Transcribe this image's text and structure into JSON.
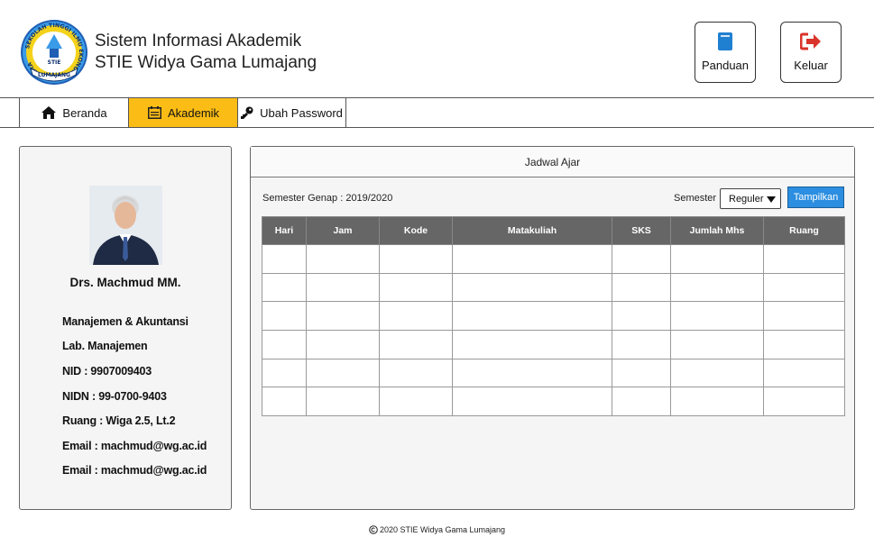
{
  "header": {
    "title_line1": "Sistem Informasi Akademik",
    "title_line2": "STIE Widya Gama Lumajang",
    "logo_ring_text": "SEKOLAH TINGGI ILMU EKONOMI WIDYA GAMA",
    "logo_center_text": "STIE",
    "logo_banner_text": "LUMAJANG",
    "panduan_label": "Panduan",
    "keluar_label": "Keluar"
  },
  "nav": {
    "beranda": "Beranda",
    "akademik": "Akademik",
    "ubah_password": "Ubah Password",
    "active": "akademik"
  },
  "profile": {
    "name": "Drs. Machmud MM.",
    "details": [
      "Manajemen & Akuntansi",
      "Lab. Manajemen",
      "NID : 9907009403",
      "NIDN : 99-0700-9403",
      "Ruang : Wiga 2.5, Lt.2",
      "Email : machmud@wg.ac.id",
      "Email : machmud@wg.ac.id"
    ]
  },
  "schedule": {
    "title": "Jadwal Ajar",
    "semester_info": "Semester Genap : 2019/2020",
    "semester_label": "Semester",
    "semester_value": "Reguler",
    "show_button": "Tampilkan",
    "columns": [
      "Hari",
      "Jam",
      "Kode",
      "Matakuliah",
      "SKS",
      "Jumlah Mhs",
      "Ruang"
    ],
    "empty_row_count": 6
  },
  "footer": {
    "text": "2020 STIE Widya Gama Lumajang"
  },
  "colors": {
    "nav_active": "#fbbd15",
    "button_primary": "#2b8ee0",
    "table_header": "#666666",
    "panduan_icon": "#1f7fd1",
    "keluar_icon": "#d9342b"
  }
}
